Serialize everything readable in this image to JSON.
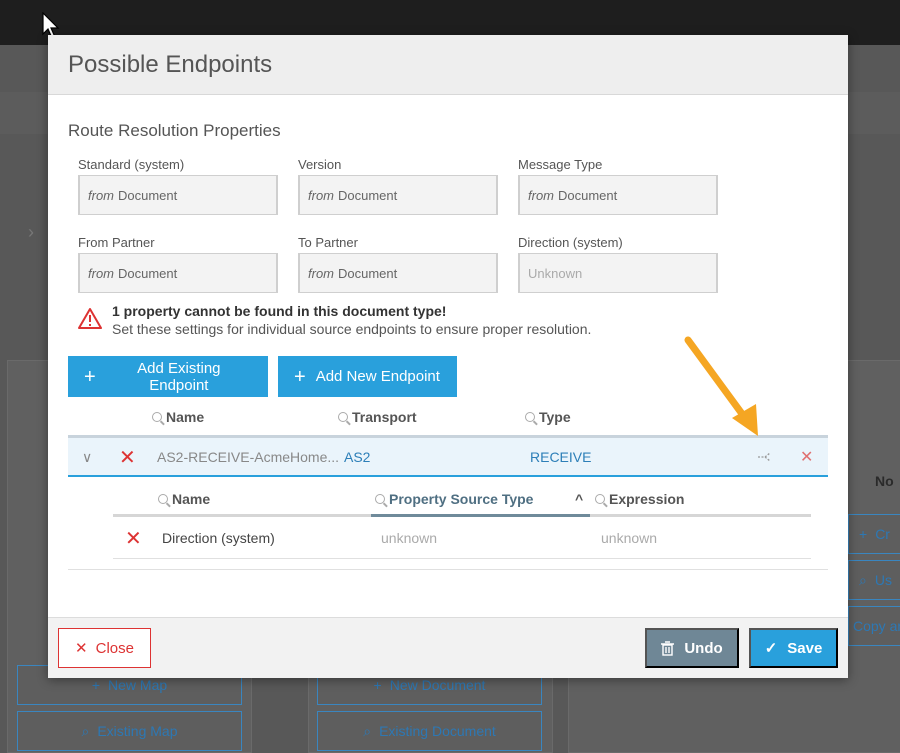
{
  "modal": {
    "title": "Possible Endpoints",
    "section_title": "Route Resolution Properties"
  },
  "fields": [
    {
      "label": "Standard (system)",
      "prefix": "from",
      "value": "Document"
    },
    {
      "label": "Version",
      "prefix": "from",
      "value": "Document"
    },
    {
      "label": "Message Type",
      "prefix": "from",
      "value": "Document"
    },
    {
      "label": "From Partner",
      "prefix": "from",
      "value": "Document"
    },
    {
      "label": "To Partner",
      "prefix": "from",
      "value": "Document"
    },
    {
      "label": "Direction (system)",
      "prefix": "",
      "value": "Unknown"
    }
  ],
  "warning": {
    "title": "1 property cannot be found in this document type!",
    "body": "Set these settings for individual source endpoints to ensure proper resolution."
  },
  "buttons": {
    "add_existing": "Add Existing Endpoint",
    "add_new": "Add New Endpoint",
    "close": "Close",
    "undo": "Undo",
    "save": "Save"
  },
  "endpoints_grid": {
    "columns": [
      "Name",
      "Transport",
      "Type"
    ],
    "rows": [
      {
        "name": "AS2-RECEIVE-AcmeHome...",
        "transport": "AS2",
        "type": "RECEIVE"
      }
    ]
  },
  "properties_grid": {
    "columns": [
      "Name",
      "Property Source Type",
      "Expression"
    ],
    "sort_indicator": "^",
    "rows": [
      {
        "name": "Direction (system)",
        "source_type": "unknown",
        "expression": "unknown"
      }
    ]
  },
  "background": {
    "new_map": "New Map",
    "existing_map": "Existing Map",
    "new_document": "New Document",
    "existing_document": "Existing Document",
    "right_partial_1": "Cr",
    "right_partial_2": "Us",
    "right_partial_3": "Copy ar",
    "right_no": "No"
  },
  "colors": {
    "accent": "#29a0dc",
    "danger": "#dd3333",
    "undo": "#6f8796",
    "arrow": "#f5a623"
  },
  "icons": [
    "warning-icon",
    "plus-icon",
    "search-icon",
    "chevron-down-icon",
    "close-icon",
    "route-icon",
    "trash-icon",
    "check-icon",
    "sort-up-icon"
  ]
}
